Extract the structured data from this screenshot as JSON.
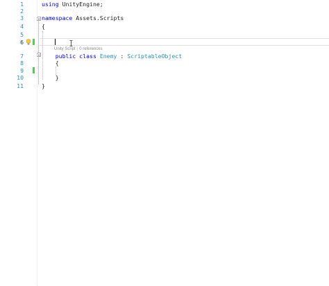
{
  "editor": {
    "line_numbers": [
      "1",
      "2",
      "3",
      "4",
      "5",
      "6",
      "7",
      "8",
      "9",
      "10",
      "11"
    ],
    "lines": [
      {
        "tokens": [
          {
            "t": "using",
            "c": "kw"
          },
          {
            "t": " UnityEngine;",
            "c": "plain"
          }
        ]
      },
      {
        "tokens": []
      },
      {
        "tokens": [
          {
            "t": "namespace",
            "c": "kw"
          },
          {
            "t": " Assets.Scripts",
            "c": "plain"
          }
        ]
      },
      {
        "tokens": [
          {
            "t": "{",
            "c": "plain"
          }
        ]
      },
      {
        "tokens": []
      },
      {
        "tokens": []
      },
      {
        "tokens": [
          {
            "t": "    ",
            "c": "plain"
          },
          {
            "t": "public",
            "c": "kw"
          },
          {
            "t": " ",
            "c": "plain"
          },
          {
            "t": "class",
            "c": "kw"
          },
          {
            "t": " ",
            "c": "plain"
          },
          {
            "t": "Enemy",
            "c": "type"
          },
          {
            "t": " : ",
            "c": "plain"
          },
          {
            "t": "ScriptableObject",
            "c": "type"
          }
        ]
      },
      {
        "tokens": [
          {
            "t": "    {",
            "c": "plain"
          }
        ]
      },
      {
        "tokens": []
      },
      {
        "tokens": [
          {
            "t": "    }",
            "c": "plain"
          }
        ]
      },
      {
        "tokens": [
          {
            "t": "}",
            "c": "plain"
          }
        ]
      }
    ],
    "codelens": {
      "part1": "Unity Script",
      "separator": "|",
      "part2": "0 references"
    },
    "colors": {
      "keyword": "#0000ff",
      "type": "#2b91af",
      "line_number": "#2b91af",
      "change_bar": "#5bc85b"
    }
  }
}
